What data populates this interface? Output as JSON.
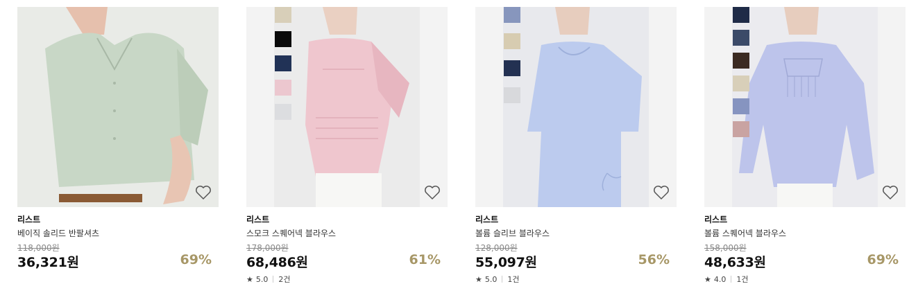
{
  "products": [
    {
      "brand": "리스트",
      "name": "베이직 솔리드 반팔셔츠",
      "original_price": "118,000원",
      "price": "36,321원",
      "discount": "69%",
      "swatches": [],
      "image_bg": "#eef0ec",
      "garment_color": "#c7d6c5",
      "icon": "heart-outline-icon"
    },
    {
      "brand": "리스트",
      "name": "스모크 스퀘어넥 블라우스",
      "original_price": "178,000원",
      "price": "68,486원",
      "discount": "61%",
      "rating": "5.0",
      "reviews": "2건",
      "swatches": [
        "#d8cfb9",
        "#0a0a0a",
        "#213256",
        "#ecc7cf",
        "#dcdde0"
      ],
      "image_bg": "#f0f0f0",
      "garment_color": "#eec3cc",
      "icon": "heart-outline-icon"
    },
    {
      "brand": "리스트",
      "name": "볼륨 슬리브 블라우스",
      "original_price": "128,000원",
      "price": "55,097원",
      "discount": "56%",
      "rating": "5.0",
      "reviews": "1건",
      "swatches": [
        "#8796bd",
        "#d7ccb1",
        "#233152",
        "#d8d9dc"
      ],
      "image_bg": "#e9eaee",
      "garment_color": "#b9c8ec",
      "icon": "heart-outline-icon"
    },
    {
      "brand": "리스트",
      "name": "볼륨 스퀘어넥 블라우스",
      "original_price": "158,000원",
      "price": "48,633원",
      "discount": "69%",
      "rating": "4.0",
      "reviews": "1건",
      "swatches": [
        "#1f2b47",
        "#3b4a68",
        "#3b2a21",
        "#d8cfb9",
        "#8694c0",
        "#c9a3a2"
      ],
      "image_bg": "#ececf0",
      "garment_color": "#bcc4ea",
      "icon": "heart-outline-icon"
    }
  ],
  "colors": {
    "discount": "#a79767",
    "price": "#111111",
    "original_price": "#888888"
  },
  "icons": {
    "star": "star-icon",
    "heart": "heart-outline-icon"
  }
}
